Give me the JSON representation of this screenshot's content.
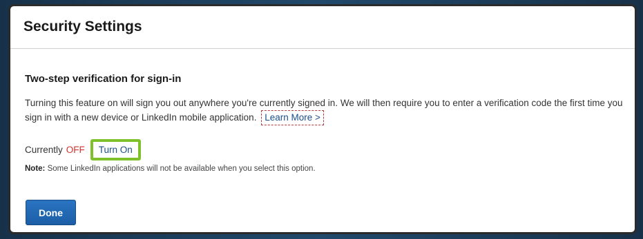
{
  "dialog": {
    "title": "Security Settings"
  },
  "section": {
    "title": "Two-step verification for sign-in",
    "description": "Turning this feature on will sign you out anywhere you're currently signed in. We will then require you to enter a verification code the first time you sign in with a new device or LinkedIn mobile application.",
    "learn_more_label": "Learn More >"
  },
  "status": {
    "label": "Currently",
    "value": "OFF",
    "value_color": "#d0342c",
    "toggle_label": "Turn On",
    "toggle_highlight_color": "#7fc12a"
  },
  "note": {
    "prefix": "Note:",
    "text": "Some LinkedIn applications will not be available when you select this option."
  },
  "footer": {
    "done_label": "Done"
  }
}
